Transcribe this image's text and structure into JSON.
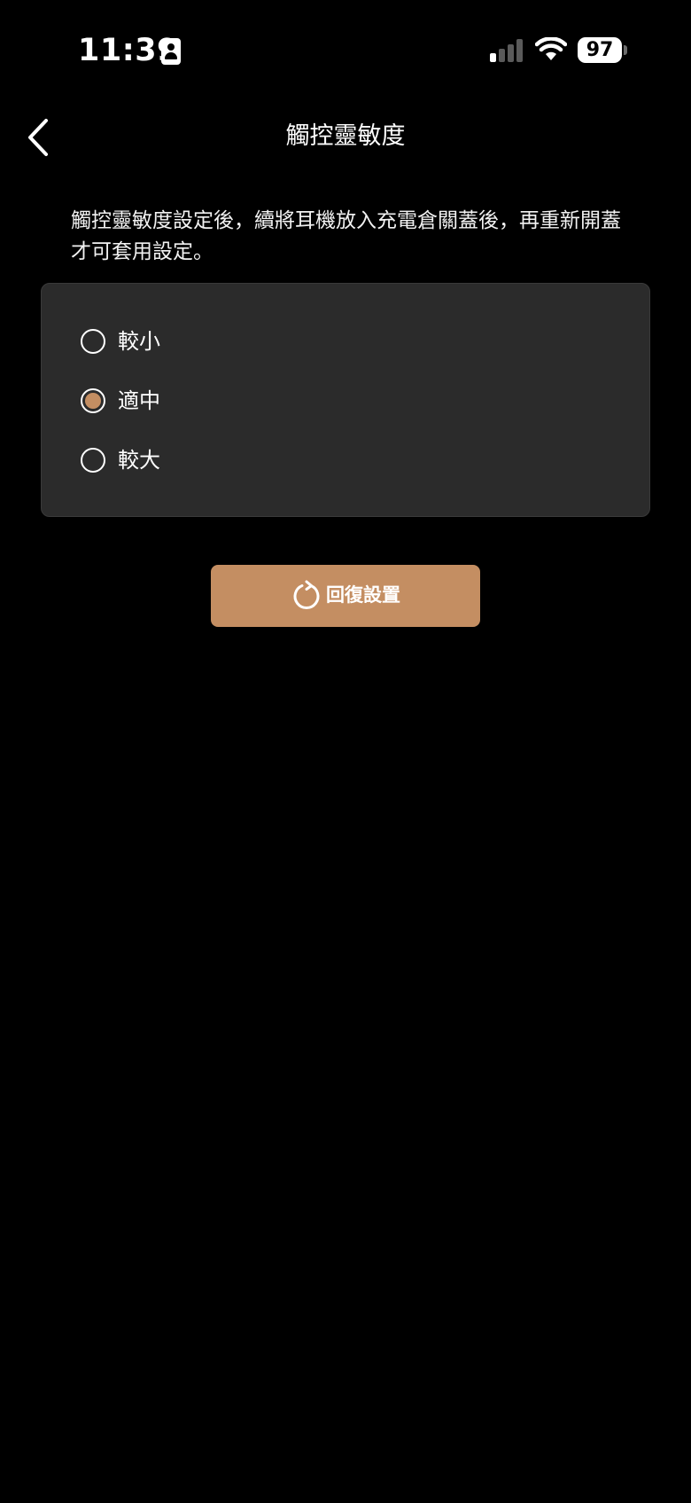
{
  "status_bar": {
    "time": "11:39",
    "battery": "97",
    "icons": [
      "person-id-icon",
      "cellular-signal-icon",
      "wifi-icon",
      "battery-icon"
    ]
  },
  "nav": {
    "back_icon": "chevron-left-icon",
    "title": "觸控靈敏度"
  },
  "description": "觸控靈敏度設定後，續將耳機放入充電倉關蓋後，再重新開蓋才可套用設定。",
  "options": [
    {
      "label": "較小",
      "selected": false
    },
    {
      "label": "適中",
      "selected": true
    },
    {
      "label": "較大",
      "selected": false
    }
  ],
  "reset_button": {
    "label": "回復設置",
    "icon": "reset-icon"
  },
  "colors": {
    "accent": "#c48e62",
    "card_bg": "#2b2b2b",
    "background": "#000000",
    "signal_active": "#ffffff",
    "signal_inactive": "#5a5a5a"
  }
}
